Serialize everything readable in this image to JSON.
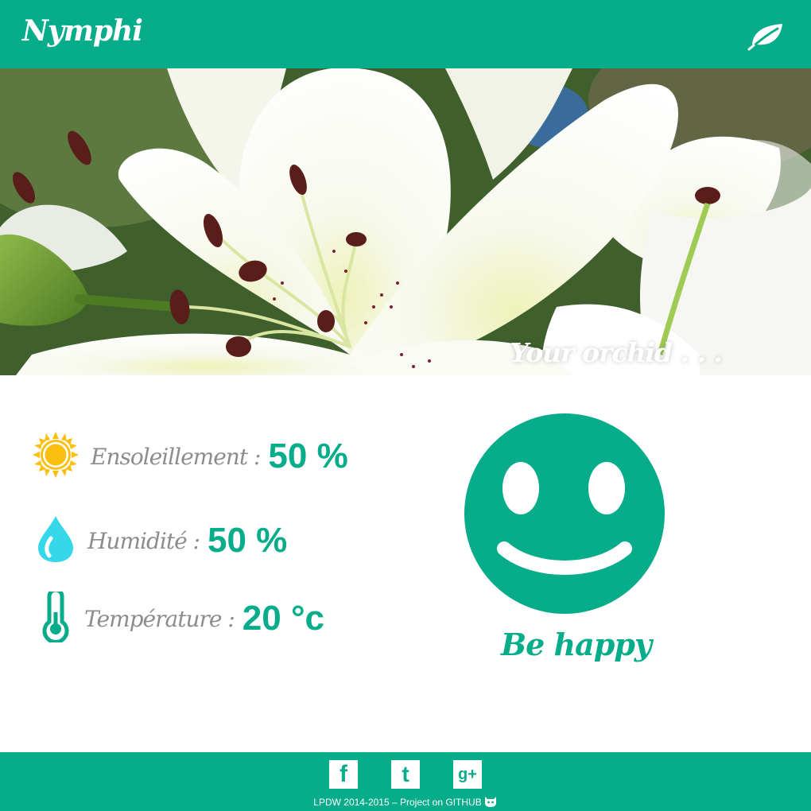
{
  "header": {
    "brand": "Nymphi",
    "leaf_icon": "leaf-icon",
    "background_color": "#07ad8a"
  },
  "hero": {
    "caption": "Your orchid . . ."
  },
  "stats": {
    "sunlight": {
      "label": "Ensoleillement :",
      "value": "50 %",
      "icon": "sun-icon"
    },
    "humidity": {
      "label": "Humidité :",
      "value": "50 %",
      "icon": "water-drop-icon"
    },
    "temperature": {
      "label": "Température :",
      "value": "20 °c",
      "icon": "thermometer-icon"
    }
  },
  "mood": {
    "label": "Be happy",
    "icon": "smiley-icon",
    "color": "#07ad8a"
  },
  "footer": {
    "social": [
      {
        "name": "facebook",
        "glyph": "f"
      },
      {
        "name": "tumblr",
        "glyph": "t"
      },
      {
        "name": "google-plus",
        "glyph": "g+"
      }
    ],
    "copyright_prefix": "LPDW 2014-2015 – Project on ",
    "github_link": "GITHUB",
    "github_icon": "github-cat-icon"
  },
  "colors": {
    "accent": "#07ad8a",
    "label_gray": "#8c8c8c",
    "sun_yellow": "#fbbf10",
    "drop_cyan": "#35d8e8"
  }
}
